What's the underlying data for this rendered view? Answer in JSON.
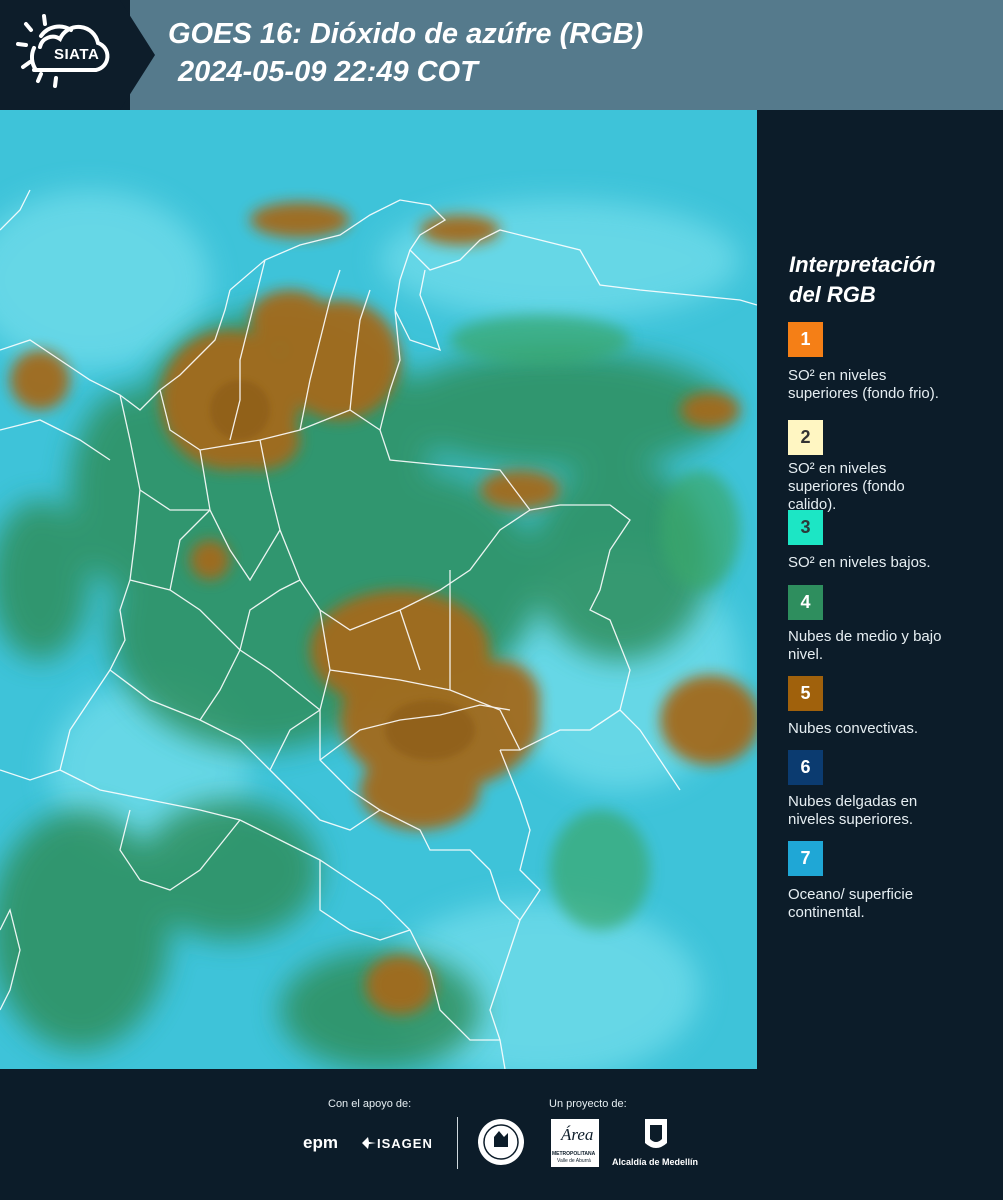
{
  "header": {
    "logo_text": "SIATA",
    "title": "GOES 16: Dióxido de azúfre (RGB)",
    "subtitle": "2024-05-09 22:49 COT"
  },
  "legend": {
    "title_line1": "Interpretación",
    "title_line2": "del RGB",
    "items": [
      {
        "num": "1",
        "color": "#f57f16",
        "text_color": "#ffffff",
        "line1": "SO² en niveles",
        "line2": "superiores (fondo frio)."
      },
      {
        "num": "2",
        "color": "#fff6c2",
        "text_color": "#333333",
        "line1": "SO² en niveles",
        "line2": "superiores (fondo",
        "line3": "calido)."
      },
      {
        "num": "3",
        "color": "#1ce6c5",
        "text_color": "#2a3a3a",
        "line1": "SO² en niveles bajos."
      },
      {
        "num": "4",
        "color": "#2e8e5e",
        "text_color": "#ffffff",
        "line1": "Nubes de medio y bajo",
        "line2": "nivel."
      },
      {
        "num": "5",
        "color": "#a0610c",
        "text_color": "#ffffff",
        "line1": "Nubes convectivas."
      },
      {
        "num": "6",
        "color": "#0b3b70",
        "text_color": "#ffffff",
        "line1": "Nubes delgadas en",
        "line2": "niveles superiores."
      },
      {
        "num": "7",
        "color": "#1fa7d6",
        "text_color": "#ffffff",
        "line1": "Oceano/ superficie",
        "line2": "continental."
      }
    ]
  },
  "footer": {
    "support_caption": "Con el apoyo de:",
    "project_caption": "Un proyecto de:",
    "sponsor_epm": "epm",
    "sponsor_isagen": "ISAGEN",
    "area_top": "Área",
    "area_line1": "METROPOLITANA",
    "area_line2": "Valle de Aburrá",
    "alcaldia": "Alcaldía de Medellín"
  },
  "colors": {
    "header_band": "#557a8c",
    "background": "#0c1c29",
    "ocean_cyan": "#39c1d6",
    "land_green": "#2f8f5d",
    "convective_brown": "#a0610c"
  }
}
